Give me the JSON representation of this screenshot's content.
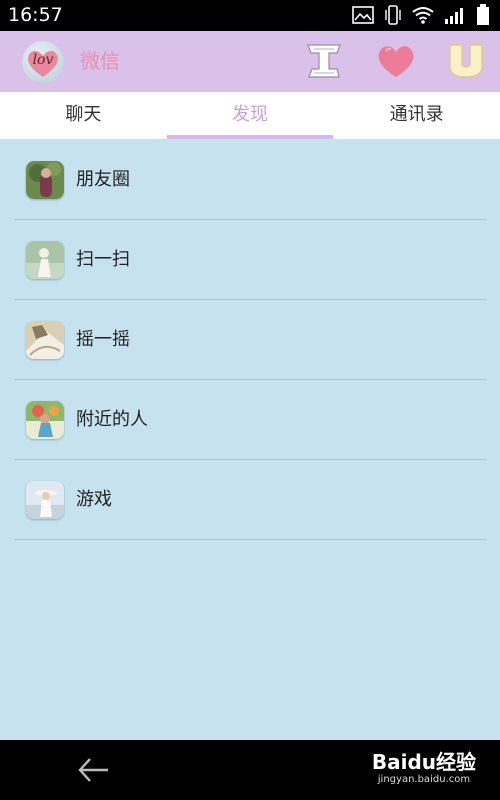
{
  "status_bar": {
    "time": "16:57",
    "icons": [
      "image-icon",
      "vibrate-icon",
      "wifi-icon",
      "signal-icon",
      "battery-icon"
    ]
  },
  "header": {
    "avatar_text": "lov",
    "title": "微信",
    "icons": [
      "app-i-icon",
      "heart-icon",
      "app-u-icon"
    ],
    "colors": {
      "background": "#d9c1ea",
      "title": "#e98fb0"
    }
  },
  "tabs": [
    {
      "label": "聊天",
      "active": false
    },
    {
      "label": "发现",
      "active": true
    },
    {
      "label": "通讯录",
      "active": false
    }
  ],
  "list": [
    {
      "label": "朋友圈",
      "thumb": "moments-thumb"
    },
    {
      "label": "扫一扫",
      "thumb": "scan-thumb"
    },
    {
      "label": "摇一摇",
      "thumb": "shake-thumb"
    },
    {
      "label": "附近的人",
      "thumb": "nearby-thumb"
    },
    {
      "label": "游戏",
      "thumb": "games-thumb"
    }
  ],
  "bottom_bar": {
    "back_icon": "back-arrow-icon",
    "watermark": {
      "logo": "Baidu经验",
      "site": "jingyan.baidu.com"
    }
  },
  "colors": {
    "list_background": "#c6e2ef",
    "active_tab": "#c8a0e0"
  }
}
